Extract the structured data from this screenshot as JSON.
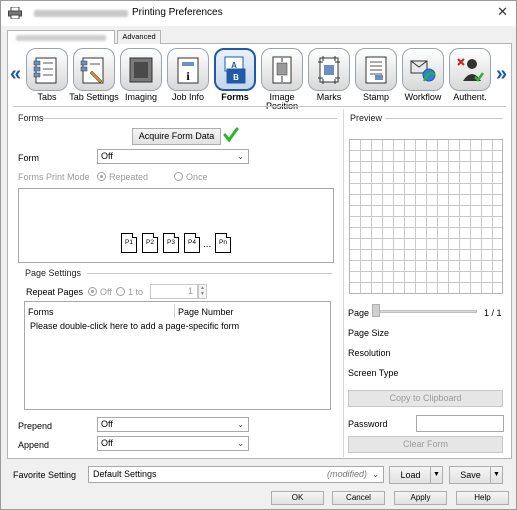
{
  "window": {
    "title": "Printing Preferences",
    "close_glyph": "✕"
  },
  "tabs": [
    {
      "label": "Advanced"
    }
  ],
  "categories": [
    {
      "label": "Tabs",
      "icon": "tabs-icon"
    },
    {
      "label": "Tab Settings",
      "icon": "tab-settings-icon"
    },
    {
      "label": "Imaging",
      "icon": "imaging-icon"
    },
    {
      "label": "Job Info",
      "icon": "job-info-icon"
    },
    {
      "label": "Forms",
      "icon": "forms-icon"
    },
    {
      "label": "Image Position",
      "icon": "image-position-icon"
    },
    {
      "label": "Marks",
      "icon": "marks-icon"
    },
    {
      "label": "Stamp",
      "icon": "stamp-icon"
    },
    {
      "label": "Workflow",
      "icon": "workflow-icon"
    },
    {
      "label": "Authent.",
      "icon": "authent-icon"
    }
  ],
  "nav": {
    "prev": "«",
    "next": "»"
  },
  "forms": {
    "group_title": "Forms",
    "acquire_button": "Acquire Form Data",
    "form_label": "Form",
    "form_value": "Off",
    "print_mode_label": "Forms Print Mode",
    "mode_repeated": "Repeated",
    "mode_once": "Once",
    "pages": [
      "P1",
      "P2",
      "P3",
      "P4"
    ],
    "pages_ellipsis": "...",
    "last_page": "Pn"
  },
  "page_settings": {
    "group_title": "Page Settings",
    "repeat_label": "Repeat Pages",
    "repeat_off": "Off",
    "repeat_range": "1 to",
    "range_value": "1",
    "col_forms": "Forms",
    "col_page_number": "Page Number",
    "hint": "Please double-click here to add a page-specific form"
  },
  "prepend": {
    "label": "Prepend",
    "value": "Off"
  },
  "append": {
    "label": "Append",
    "value": "Off"
  },
  "preview": {
    "group_title": "Preview",
    "page_label": "Page",
    "page_value": "1 / 1",
    "page_size": "Page Size",
    "resolution": "Resolution",
    "screen_type": "Screen Type",
    "copy_button": "Copy to Clipboard",
    "password_label": "Password",
    "clear_button": "Clear Form"
  },
  "favorite": {
    "label": "Favorite Setting",
    "value": "Default Settings",
    "modified": "(modified)",
    "load": "Load",
    "save": "Save"
  },
  "footer": {
    "ok": "OK",
    "cancel": "Cancel",
    "apply": "Apply",
    "help": "Help"
  },
  "colors": {
    "accent": "#1f5aa6",
    "check": "#2db52d"
  }
}
